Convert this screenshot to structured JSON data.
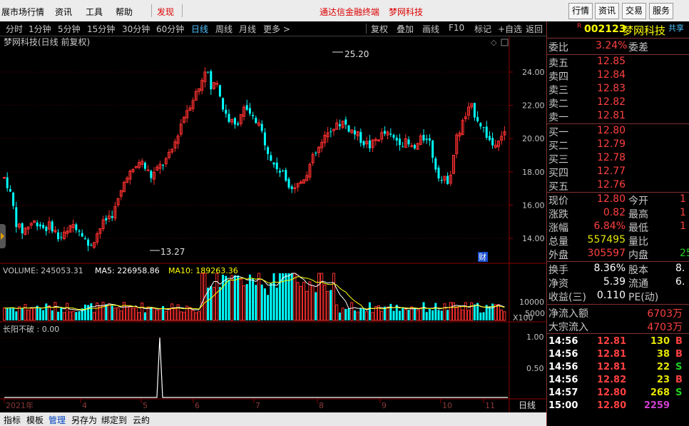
{
  "menubar": {
    "items": [
      "展市场行情",
      "资讯",
      "工具",
      "帮助"
    ],
    "discover": "发现",
    "center_title": "通达信金融终端",
    "center_stock": "梦网科技",
    "right_buttons": [
      "行情",
      "资讯",
      "交易",
      "服务"
    ]
  },
  "toolbar": {
    "periods": [
      "分时",
      "1分钟",
      "5分钟",
      "15分钟",
      "30分钟",
      "60分钟",
      "日线",
      "周线",
      "月线",
      "更多 >"
    ],
    "active_period": "日线",
    "actions": [
      "复权",
      "叠加",
      "画线",
      "F10",
      "标记",
      "+自选",
      "返回"
    ]
  },
  "chart": {
    "title": "梦网科技(日线 前复权)",
    "high_label": "25.20",
    "low_label": "13.27",
    "price_ticks": [
      "24.00",
      "22.00",
      "20.00",
      "18.00",
      "16.00",
      "14.00"
    ],
    "cai_badge": "财",
    "volume": {
      "vol_label": "VOLUME: 245053.31",
      "ma5_label": "MA5: 226958.86",
      "ma10_label": "MA10: 189263.36",
      "ticks": [
        "10000",
        "5000"
      ],
      "unit": "X100"
    },
    "indicator": {
      "label": "长阳不破 : 0.00",
      "ticks": [
        "1.00",
        "0.50"
      ]
    },
    "months": [
      "2021年",
      "4",
      "5",
      "6",
      "7",
      "8",
      "9",
      "10",
      "11"
    ],
    "period_label": "日线",
    "colors": {
      "up": "#ff3030",
      "down": "#00ffff",
      "ma5": "#ffffff",
      "ma10": "#ffff00",
      "grid": "#8b0000"
    }
  },
  "bottombar": {
    "tabs": [
      "指标",
      "模板",
      "管理",
      "另存为",
      "绑定到",
      "云約"
    ],
    "active_tab": "管理"
  },
  "quote": {
    "code": "002123",
    "name": "梦网科技",
    "share": "共享",
    "webi_label": "委比",
    "webi_value": "3.24%",
    "weicha_label": "委差",
    "asks": [
      {
        "label": "卖五",
        "price": "12.85"
      },
      {
        "label": "卖四",
        "price": "12.84"
      },
      {
        "label": "卖三",
        "price": "12.83"
      },
      {
        "label": "卖二",
        "price": "12.82"
      },
      {
        "label": "卖一",
        "price": "12.81"
      }
    ],
    "bids": [
      {
        "label": "买一",
        "price": "12.80"
      },
      {
        "label": "买二",
        "price": "12.79"
      },
      {
        "label": "买三",
        "price": "12.78"
      },
      {
        "label": "买四",
        "price": "12.77"
      },
      {
        "label": "买五",
        "price": "12.76"
      }
    ],
    "stats": [
      {
        "l1": "现价",
        "v1": "12.80",
        "l2": "今开",
        "v2": "1"
      },
      {
        "l1": "涨跌",
        "v1": "0.82",
        "l2": "最高",
        "v2": "1"
      },
      {
        "l1": "涨幅",
        "v1": "6.84%",
        "l2": "最低",
        "v2": "1"
      },
      {
        "l1": "总量",
        "v1": "557495",
        "l2": "量比",
        "v2": ""
      },
      {
        "l1": "外盘",
        "v1": "305597",
        "l2": "内盘",
        "v2": "25"
      }
    ],
    "stats2": [
      {
        "l1": "换手",
        "v1": "8.36%",
        "l2": "股本",
        "v2": "8."
      },
      {
        "l1": "净资",
        "v1": "5.39",
        "l2": "流通",
        "v2": "6."
      },
      {
        "l1": "收益(三)",
        "v1": "0.110",
        "l2": "PE(动)",
        "v2": ""
      }
    ],
    "flows": [
      {
        "label": "净流入额",
        "value": "6703万"
      },
      {
        "label": "大宗流入",
        "value": "4703万"
      }
    ],
    "ticks": [
      {
        "time": "14:56",
        "price": "12.81",
        "vol": "130",
        "bs": "B"
      },
      {
        "time": "14:56",
        "price": "12.81",
        "vol": "38",
        "bs": "B"
      },
      {
        "time": "14:56",
        "price": "12.81",
        "vol": "22",
        "bs": "S"
      },
      {
        "time": "14:56",
        "price": "12.82",
        "vol": "23",
        "bs": "B"
      },
      {
        "time": "14:57",
        "price": "12.80",
        "vol": "268",
        "bs": "S"
      },
      {
        "time": "15:00",
        "price": "12.80",
        "vol": "2259",
        "bs": ""
      }
    ]
  }
}
